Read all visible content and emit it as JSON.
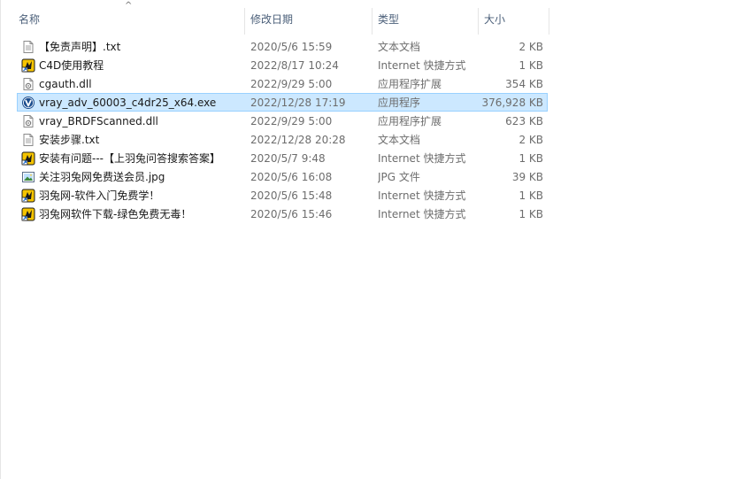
{
  "columns": {
    "name": "名称",
    "date": "修改日期",
    "type": "类型",
    "size": "大小"
  },
  "sort_indicator": "^",
  "files": [
    {
      "name": "【免责声明】.txt",
      "date": "2020/5/6 15:59",
      "type": "文本文档",
      "size": "2 KB",
      "icon": "text-file-icon"
    },
    {
      "name": "C4D使用教程",
      "date": "2022/8/17 10:24",
      "type": "Internet 快捷方式",
      "size": "1 KB",
      "icon": "internet-shortcut-icon"
    },
    {
      "name": "cgauth.dll",
      "date": "2022/9/29 5:00",
      "type": "应用程序扩展",
      "size": "354 KB",
      "icon": "dll-file-icon"
    },
    {
      "name": "vray_adv_60003_c4dr25_x64.exe",
      "date": "2022/12/28 17:19",
      "type": "应用程序",
      "size": "376,928 KB",
      "icon": "vray-exe-icon",
      "selected": true
    },
    {
      "name": "vray_BRDFScanned.dll",
      "date": "2022/9/29 5:00",
      "type": "应用程序扩展",
      "size": "623 KB",
      "icon": "dll-file-icon"
    },
    {
      "name": "安装步骤.txt",
      "date": "2022/12/28 20:28",
      "type": "文本文档",
      "size": "2 KB",
      "icon": "text-file-icon"
    },
    {
      "name": "安装有问题---【上羽兔问答搜索答案】",
      "date": "2020/5/7 9:48",
      "type": "Internet 快捷方式",
      "size": "1 KB",
      "icon": "internet-shortcut-icon"
    },
    {
      "name": "关注羽兔网免费送会员.jpg",
      "date": "2020/5/6 16:08",
      "type": "JPG 文件",
      "size": "39 KB",
      "icon": "image-file-icon"
    },
    {
      "name": "羽兔网-软件入门免费学！",
      "date": "2020/5/6 15:48",
      "type": "Internet 快捷方式",
      "size": "1 KB",
      "icon": "internet-shortcut-icon"
    },
    {
      "name": "羽兔网软件下载-绿色免费无毒！",
      "date": "2020/5/6 15:46",
      "type": "Internet 快捷方式",
      "size": "1 KB",
      "icon": "internet-shortcut-icon"
    }
  ],
  "colors": {
    "selection_bg": "#cce8ff",
    "selection_border": "#99d1ff",
    "header_text": "#4c607a",
    "meta_text": "#6d6d6d"
  }
}
